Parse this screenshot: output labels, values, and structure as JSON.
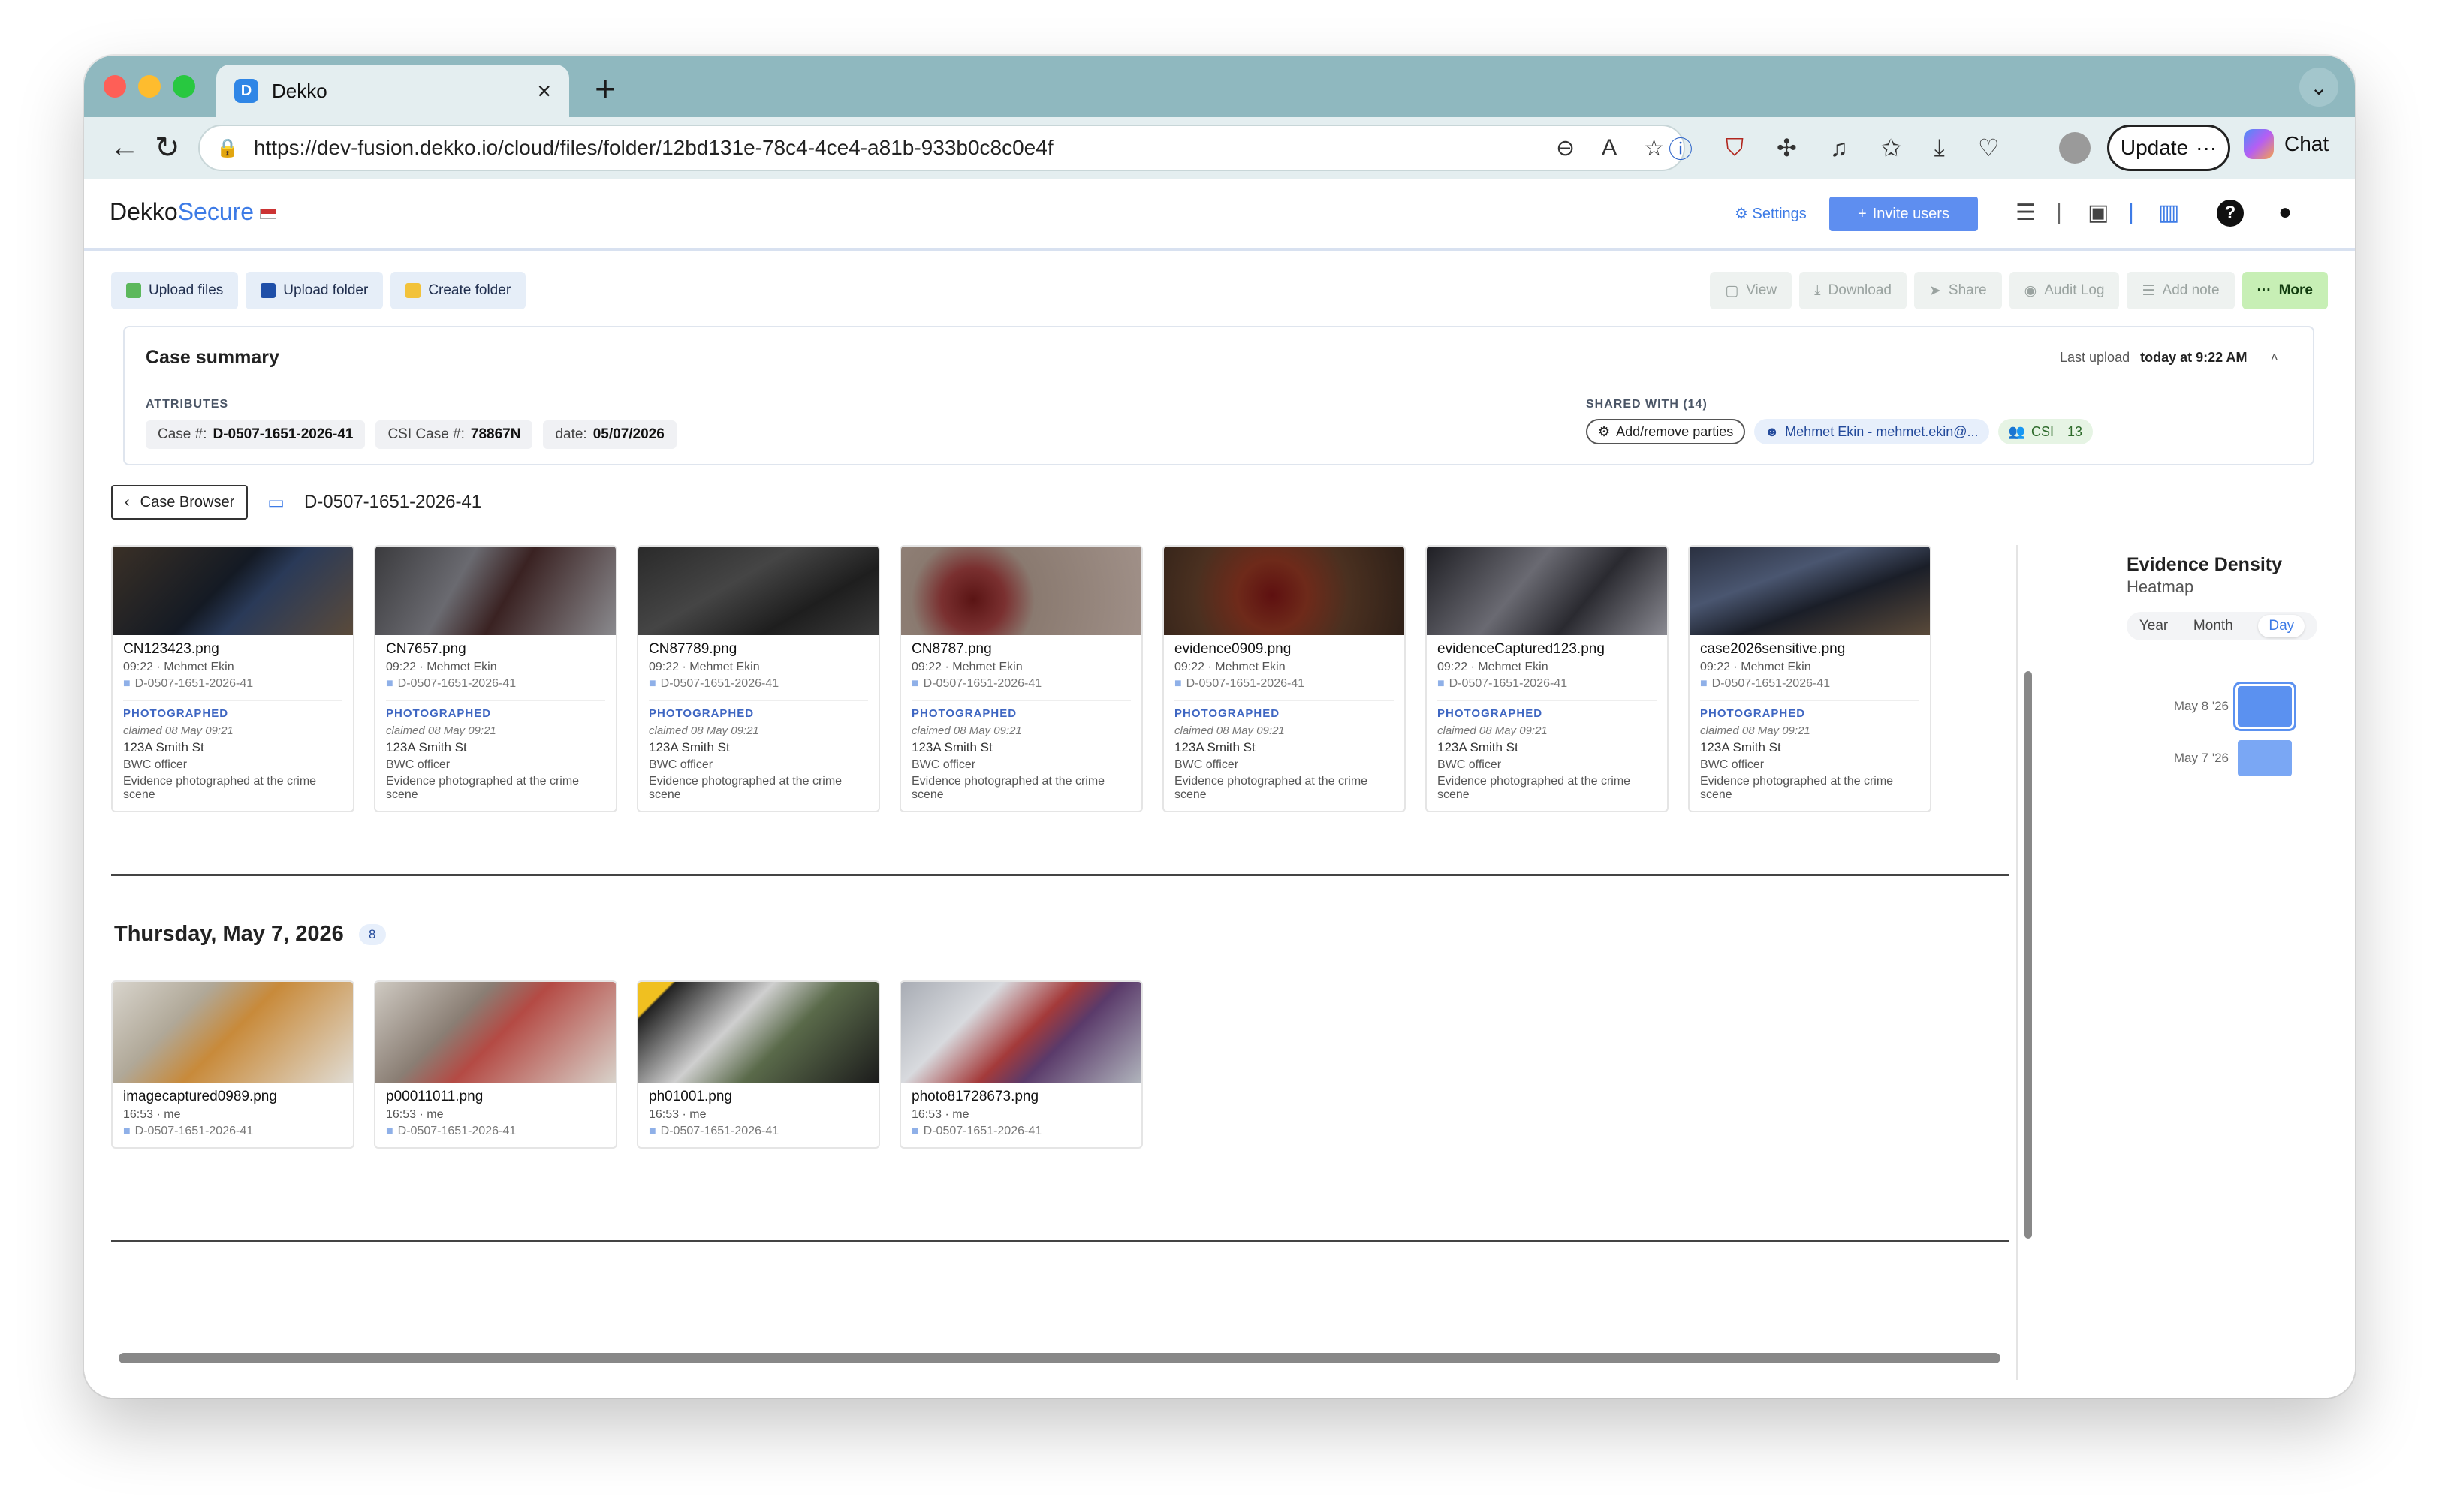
{
  "browser": {
    "tab_title": "Dekko",
    "tab_favicon": "D",
    "url": "https://dev-fusion.dekko.io/cloud/files/folder/12bd131e-78c4-4ce4-a81b-933b0c8c0e4f",
    "update_label": "Update",
    "chat_label": "Chat"
  },
  "app": {
    "logo_a": "Dekko",
    "logo_b": "Secure",
    "settings_label": "Settings",
    "invite_label": "Invite users"
  },
  "toolbar": {
    "upload_files": "Upload files",
    "upload_folder": "Upload folder",
    "create_folder": "Create folder",
    "view": "View",
    "download": "Download",
    "share": "Share",
    "audit_log": "Audit Log",
    "add_note": "Add note",
    "more": "More"
  },
  "summary": {
    "title": "Case summary",
    "last_upload_label": "Last upload",
    "last_upload_value": "today at 9:22 AM",
    "attributes_label": "ATTRIBUTES",
    "attributes": [
      {
        "key": "Case #:",
        "value": "D-0507-1651-2026-41"
      },
      {
        "key": "CSI Case #:",
        "value": "78867N"
      },
      {
        "key": "date:",
        "value": "05/07/2026"
      }
    ],
    "shared_label": "SHARED WITH (14)",
    "add_remove": "Add/remove parties",
    "shared_user": "Mehmet Ekin - mehmet.ekin@...",
    "group_name": "CSI",
    "group_count": "13"
  },
  "breadcrumb": {
    "back_label": "Case Browser",
    "path": "D-0507-1651-2026-41"
  },
  "group1": {
    "cards": [
      {
        "name": "CN123423.png",
        "meta": "09:22 · Mehmet Ekin",
        "path": "D-0507-1651-2026-41",
        "badge": "PHOTOGRAPHED",
        "claimed": "claimed 08 May 09:21",
        "addr": "123A Smith St",
        "role": "BWC officer",
        "note": "Evidence photographed at the crime scene"
      },
      {
        "name": "CN7657.png",
        "meta": "09:22 · Mehmet Ekin",
        "path": "D-0507-1651-2026-41",
        "badge": "PHOTOGRAPHED",
        "claimed": "claimed 08 May 09:21",
        "addr": "123A Smith St",
        "role": "BWC officer",
        "note": "Evidence photographed at the crime scene"
      },
      {
        "name": "CN87789.png",
        "meta": "09:22 · Mehmet Ekin",
        "path": "D-0507-1651-2026-41",
        "badge": "PHOTOGRAPHED",
        "claimed": "claimed 08 May 09:21",
        "addr": "123A Smith St",
        "role": "BWC officer",
        "note": "Evidence photographed at the crime scene"
      },
      {
        "name": "CN8787.png",
        "meta": "09:22 · Mehmet Ekin",
        "path": "D-0507-1651-2026-41",
        "badge": "PHOTOGRAPHED",
        "claimed": "claimed 08 May 09:21",
        "addr": "123A Smith St",
        "role": "BWC officer",
        "note": "Evidence photographed at the crime scene"
      },
      {
        "name": "evidence0909.png",
        "meta": "09:22 · Mehmet Ekin",
        "path": "D-0507-1651-2026-41",
        "badge": "PHOTOGRAPHED",
        "claimed": "claimed 08 May 09:21",
        "addr": "123A Smith St",
        "role": "BWC officer",
        "note": "Evidence photographed at the crime scene"
      },
      {
        "name": "evidenceCaptured123.png",
        "meta": "09:22 · Mehmet Ekin",
        "path": "D-0507-1651-2026-41",
        "badge": "PHOTOGRAPHED",
        "claimed": "claimed 08 May 09:21",
        "addr": "123A Smith St",
        "role": "BWC officer",
        "note": "Evidence photographed at the crime scene"
      },
      {
        "name": "case2026sensitive.png",
        "meta": "09:22 · Mehmet Ekin",
        "path": "D-0507-1651-2026-41",
        "badge": "PHOTOGRAPHED",
        "claimed": "claimed 08 May 09:21",
        "addr": "123A Smith St",
        "role": "BWC officer",
        "note": "Evidence photographed at the crime scene"
      }
    ]
  },
  "group2": {
    "title": "Thursday, May 7, 2026",
    "count": "8",
    "cards": [
      {
        "name": "imagecaptured0989.png",
        "meta": "16:53 · me",
        "path": "D-0507-1651-2026-41"
      },
      {
        "name": "p00011011.png",
        "meta": "16:53 · me",
        "path": "D-0507-1651-2026-41"
      },
      {
        "name": "ph01001.png",
        "meta": "16:53 · me",
        "path": "D-0507-1651-2026-41"
      },
      {
        "name": "photo81728673.png",
        "meta": "16:53 · me",
        "path": "D-0507-1651-2026-41"
      }
    ]
  },
  "heatmap": {
    "title": "Evidence Density",
    "subtitle": "Heatmap",
    "tabs": [
      "Year",
      "Month",
      "Day"
    ],
    "active_tab": "Day",
    "rows": [
      {
        "label": "May 8 '26"
      },
      {
        "label": "May 7 '26"
      }
    ]
  },
  "colors": {
    "accent": "#3d7be6",
    "invite": "#5e8ef0",
    "more_bg": "#c7efb5",
    "heat": "#5b91f0"
  }
}
